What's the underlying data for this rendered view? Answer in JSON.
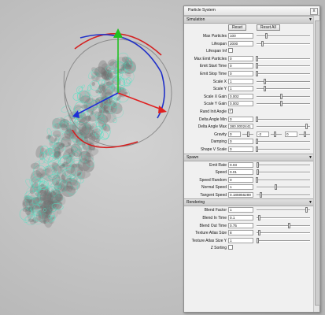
{
  "panel": {
    "title": "Particle System",
    "close_glyph": "x",
    "sections": [
      {
        "id": "simulation",
        "label": "Simulation",
        "buttons": [
          "Reset",
          "Reset All"
        ],
        "rows": [
          {
            "label": "Max Particles",
            "type": "slider",
            "value": "100",
            "level": 0.18
          },
          {
            "label": "Lifespan",
            "type": "slider",
            "value": "2000",
            "level": 0.1
          },
          {
            "label": "Lifespan Inf",
            "type": "check",
            "checked": false
          },
          {
            "label": "Max Emit Particles",
            "type": "slider",
            "value": "0",
            "level": 0.0
          },
          {
            "label": "Emit Start Time",
            "type": "slider",
            "value": "0",
            "level": 0.0
          },
          {
            "label": "Emit Stop Time",
            "type": "slider",
            "value": "0",
            "level": 0.0
          },
          {
            "label": "Scale X",
            "type": "slider",
            "value": "1",
            "level": 0.15
          },
          {
            "label": "Scale Y",
            "type": "slider",
            "value": "1",
            "level": 0.15
          },
          {
            "label": "Scale X Gain",
            "type": "slider",
            "value": "0.002",
            "level": 0.45
          },
          {
            "label": "Scale Y Gain",
            "type": "slider",
            "value": "0.002",
            "level": 0.45
          },
          {
            "label": "Rand Init Angle",
            "type": "check",
            "checked": true
          },
          {
            "label": "Delta Angle Min",
            "type": "slider",
            "value": "0",
            "level": 0.0
          },
          {
            "label": "Delta Angle Max",
            "type": "slider",
            "value": "380.0002441",
            "level": 0.92
          },
          {
            "label": "Gravity",
            "type": "triple",
            "values": [
              "0",
              "-2",
              "0"
            ],
            "levels": [
              0.5,
              0.35,
              0.5
            ]
          },
          {
            "label": "Damping",
            "type": "slider",
            "value": "0",
            "level": 0.0
          },
          {
            "label": "Shape V Scale",
            "type": "slider",
            "value": "0",
            "level": 0.0
          }
        ]
      },
      {
        "id": "spawn",
        "label": "Spawn",
        "rows": [
          {
            "label": "Emit Rate",
            "type": "slider",
            "value": "0.03",
            "level": 0.02
          },
          {
            "label": "Speed",
            "type": "slider",
            "value": "0.01",
            "level": 0.02
          },
          {
            "label": "Speed Random",
            "type": "slider",
            "value": "0",
            "level": 0.0
          },
          {
            "label": "Normal Speed",
            "type": "slider",
            "value": "1",
            "level": 0.35
          },
          {
            "label": "Tangent Speed",
            "type": "slider",
            "value": "0.185956289",
            "level": 0.07
          }
        ]
      },
      {
        "id": "rendering",
        "label": "Rendering",
        "rows": [
          {
            "label": "Blend Factor",
            "type": "slider",
            "value": "1",
            "level": 0.92
          },
          {
            "label": "Blend In Time",
            "type": "slider",
            "value": "0.1",
            "level": 0.05
          },
          {
            "label": "Blend Out Time",
            "type": "slider",
            "value": "0.75",
            "level": 0.6
          },
          {
            "label": "Texture Atlas Size",
            "type": "slider",
            "value": "8",
            "level": 0.05
          },
          {
            "label": "Texture Atlas Size Y",
            "type": "slider",
            "value": "1",
            "level": 0.02
          },
          {
            "label": "Z Sorting",
            "type": "check",
            "checked": false
          }
        ]
      }
    ]
  },
  "gizmo": {
    "axis_colors": {
      "x": "#e02020",
      "y": "#20c020",
      "z": "#1e2fd8"
    },
    "ring_colors": {
      "red": "#d42020",
      "blue": "#2030c8",
      "grey": "#8a8a8a"
    }
  },
  "particles": {
    "color": "#4fe3c4"
  }
}
